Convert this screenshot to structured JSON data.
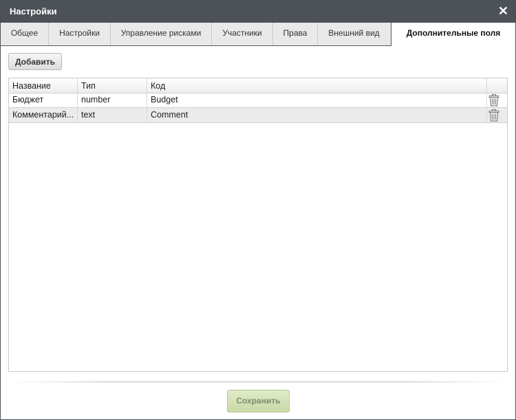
{
  "window": {
    "title": "Настройки",
    "close_symbol": "✕"
  },
  "tabs": [
    {
      "label": "Общее"
    },
    {
      "label": "Настройки"
    },
    {
      "label": "Управление рисками"
    },
    {
      "label": "Участники"
    },
    {
      "label": "Права"
    },
    {
      "label": "Внешний вид"
    },
    {
      "label": "Дополнительные поля",
      "active": true
    }
  ],
  "toolbar": {
    "add_label": "Добавить"
  },
  "grid": {
    "columns": [
      "Название",
      "Тип",
      "Код"
    ],
    "rows": [
      {
        "name": "Бюджет",
        "type": "number",
        "code": "Budget"
      },
      {
        "name": "Комментарий...",
        "type": "text",
        "code": "Comment"
      }
    ],
    "row_action_icon": "trash-icon"
  },
  "footer": {
    "save_label": "Сохранить"
  },
  "colors": {
    "titlebar": "#4d5258",
    "save_button": "#d4e2b6",
    "tab_bar": "#e9e9e9"
  }
}
